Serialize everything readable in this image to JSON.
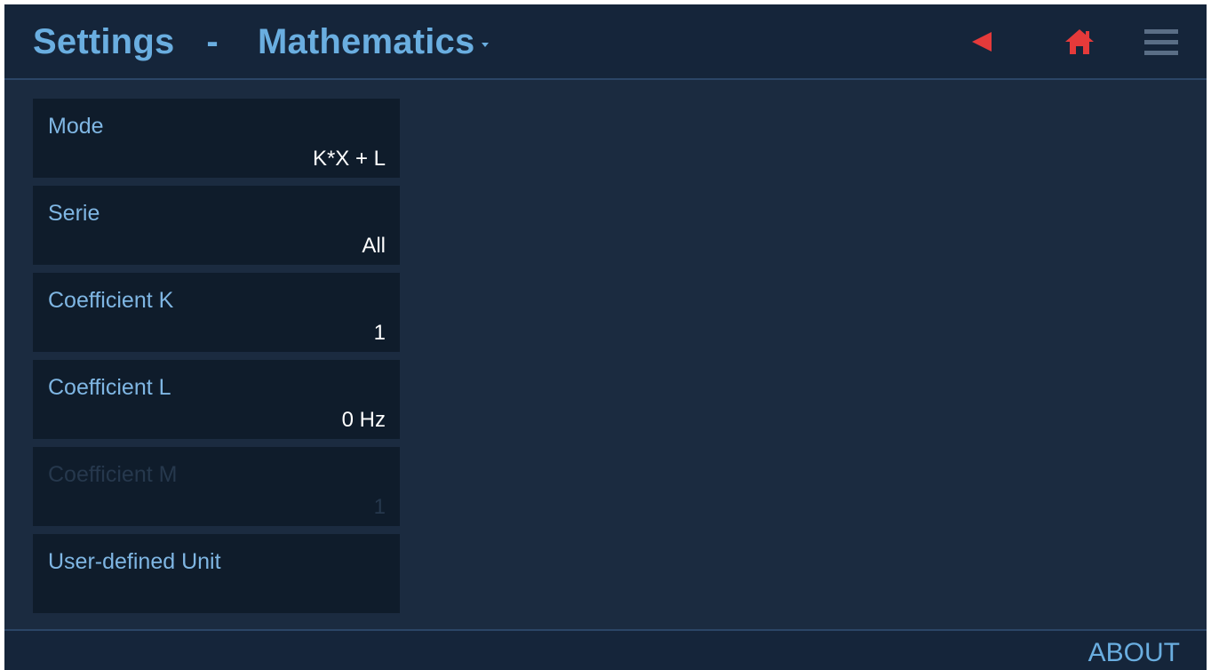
{
  "header": {
    "title": "Settings",
    "separator": "-",
    "section": "Mathematics",
    "icons": {
      "back": "back-arrow-icon",
      "home": "home-icon",
      "menu": "hamburger-menu-icon"
    },
    "accent_color": "#6aaee0",
    "alert_color": "#e53a3a"
  },
  "settings": [
    {
      "label": "Mode",
      "value": "K*X + L",
      "enabled": true
    },
    {
      "label": "Serie",
      "value": "All",
      "enabled": true
    },
    {
      "label": "Coefficient K",
      "value": "1",
      "enabled": true
    },
    {
      "label": "Coefficient L",
      "value": "0 Hz",
      "enabled": true
    },
    {
      "label": "Coefficient M",
      "value": "1",
      "enabled": false
    },
    {
      "label": "User-defined Unit",
      "value": "",
      "enabled": true
    }
  ],
  "footer": {
    "about_label": "ABOUT"
  }
}
